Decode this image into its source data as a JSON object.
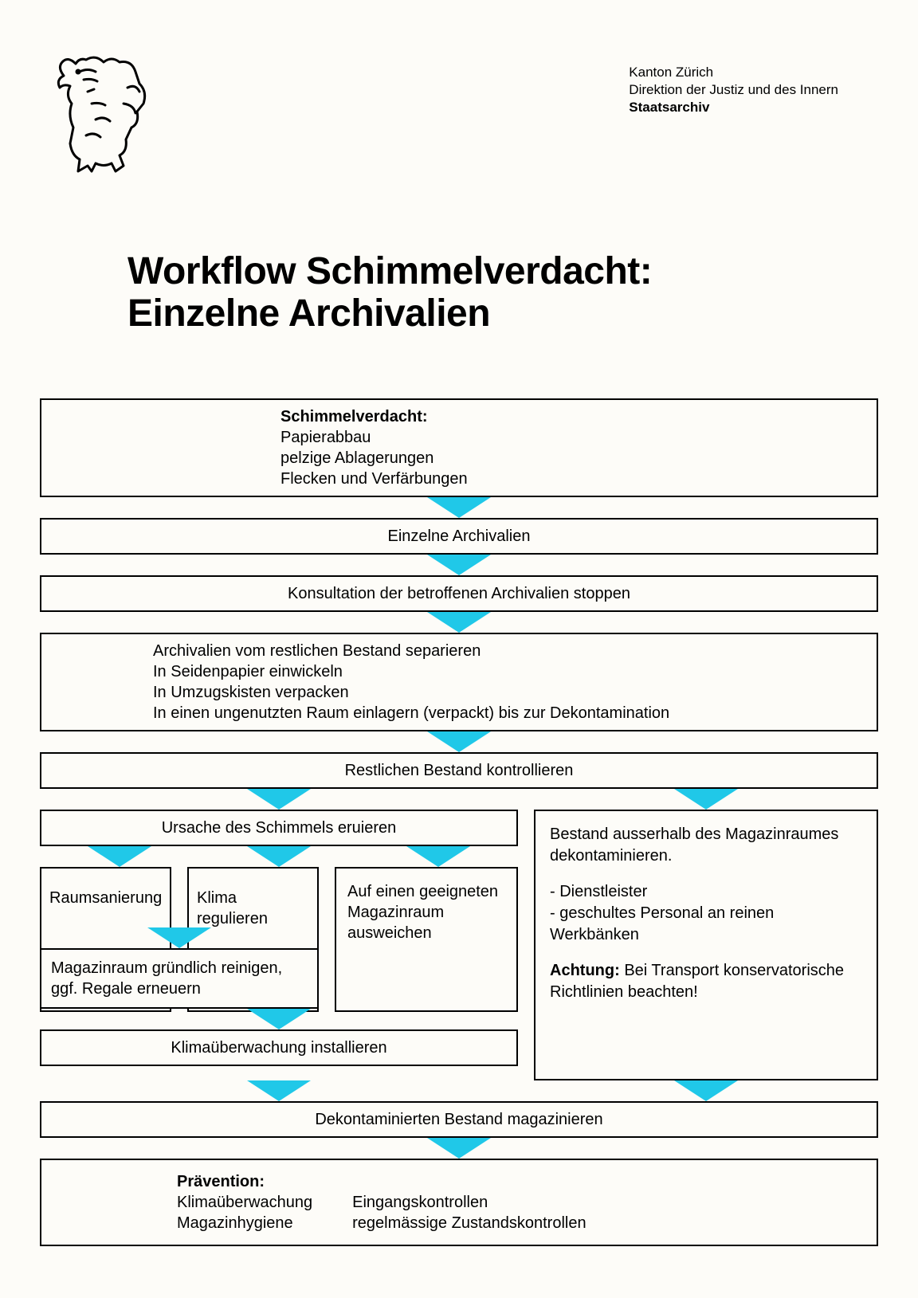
{
  "header": {
    "line1": "Kanton Zürich",
    "line2": "Direktion der Justiz und des Innern",
    "line3": "Staatsarchiv"
  },
  "title": {
    "line1": "Workflow Schimmelverdacht:",
    "line2": "Einzelne Archivalien"
  },
  "boxes": {
    "suspicion_heading": "Schimmelverdacht:",
    "suspicion_l1": "Papierabbau",
    "suspicion_l2": "pelzige Ablagerungen",
    "suspicion_l3": "Flecken und Verfärbungen",
    "single": "Einzelne Archivalien",
    "stop": "Konsultation der betroffenen Archivalien stoppen",
    "separate_l1": "Archivalien vom restlichen Bestand separieren",
    "separate_l2": "In Seidenpapier einwickeln",
    "separate_l3": "In Umzugskisten verpacken",
    "separate_l4": "In einen ungenutzten Raum einlagern (verpackt) bis zur Dekontamination",
    "control_rest": "Restlichen Bestand kontrollieren",
    "cause": "Ursache des Schimmels eruieren",
    "room_renovate": "Raumsanierung",
    "climate_reg": "Klima regulieren",
    "move_room_l1": "Auf einen geeigneten",
    "move_room_l2": "Magazinraum ausweichen",
    "clean_l1": "Magazinraum gründlich reinigen,",
    "clean_l2": "ggf. Regale erneuern",
    "climate_monitor": "Klimaüberwachung installieren",
    "decon_l1": "Bestand ausserhalb des Magazinraumes dekontaminieren.",
    "decon_l2": "- Dienstleister",
    "decon_l3": "- geschultes Personal an reinen Werkbänken",
    "decon_warn_label": "Achtung:",
    "decon_warn_text": "Bei Transport konservatorische Richtlinien beachten!",
    "store": "Dekontaminierten Bestand magazinieren",
    "prev_heading": "Prävention:",
    "prev_c1_l1": "Klimaüberwachung",
    "prev_c1_l2": "Magazinhygiene",
    "prev_c2_l1": "Eingangskontrollen",
    "prev_c2_l2": "regelmässige Zustandskontrollen"
  }
}
